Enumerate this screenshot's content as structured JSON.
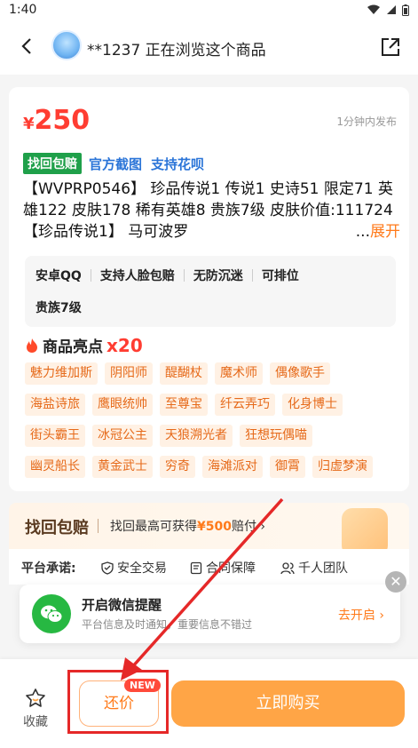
{
  "status": {
    "time": "1:40"
  },
  "header": {
    "title": "**1237 正在浏览这个商品"
  },
  "product": {
    "price_symbol": "¥",
    "price": "250",
    "publish_time": "1分钟内发布",
    "badges": {
      "recover": "找回包赔",
      "official": "官方截图",
      "huabei": "支持花呗"
    },
    "description": "【WVPRP0546】 珍品传说1 传说1 史诗51 限定71 英雄122 皮肤178 稀有英雄8 贵族7级 皮肤价值:111724 【珍品传说1】 马可波罗",
    "more_dots": "...",
    "expand_label": "展开"
  },
  "attributes": [
    "安卓QQ",
    "支持人脸包赔",
    "无防沉迷",
    "可排位",
    "贵族7级"
  ],
  "highlights": {
    "title": "商品亮点",
    "count": "x20",
    "items": [
      "魅力维加斯",
      "阴阳师",
      "醍醐杖",
      "魔术师",
      "偶像歌手",
      "海盐诗旅",
      "鹰眼统帅",
      "至尊宝",
      "纤云弄巧",
      "化身博士",
      "街头霸王",
      "冰冠公主",
      "天狼溯光者",
      "狂想玩偶喵",
      "幽灵船长",
      "黄金武士",
      "穷奇",
      "海滩派对",
      "御霄",
      "归虚梦演"
    ]
  },
  "guarantee": {
    "label": "找回包赔",
    "text_prefix": "找回最高可获得",
    "amount": "¥500",
    "text_suffix": "赔付 ›"
  },
  "promise": {
    "label": "平台承诺:",
    "items": [
      "安全交易",
      "合同保障",
      "千人团队"
    ]
  },
  "wechat": {
    "title": "开启微信提醒",
    "subtitle": "平台信息及时通知，重要信息不错过",
    "action": "去开启 ›"
  },
  "close_symbol": "✕",
  "bottom": {
    "favorite_label": "收藏",
    "bargain_label": "还价",
    "new_badge": "NEW",
    "buy_label": "立即购买"
  },
  "colors": {
    "price": "#ff3d32",
    "accent": "#ff7a1a",
    "buy": "#ffa546",
    "annotation": "#e52828"
  }
}
